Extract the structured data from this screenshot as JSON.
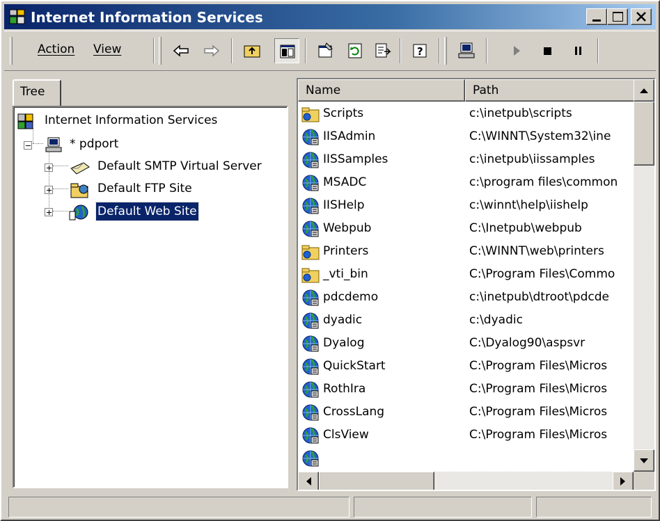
{
  "window": {
    "title": "Internet Information Services",
    "controls": {
      "minimize": "minimize",
      "maximize": "maximize",
      "close": "close"
    }
  },
  "menu": [
    {
      "label": "Action",
      "accel": "A"
    },
    {
      "label": "View",
      "accel": "V"
    }
  ],
  "toolbar": [
    {
      "name": "back",
      "icon": "arrow-left-icon"
    },
    {
      "name": "forward",
      "icon": "arrow-right-icon"
    },
    {
      "name": "up-one-level",
      "icon": "folder-up-icon"
    },
    {
      "name": "show-hide-console-tree",
      "icon": "console-tree-icon",
      "pressed": true
    },
    {
      "name": "properties",
      "icon": "properties-icon"
    },
    {
      "name": "refresh",
      "icon": "refresh-icon"
    },
    {
      "name": "export-list",
      "icon": "export-list-icon"
    },
    {
      "name": "help",
      "icon": "help-icon"
    },
    {
      "name": "connect-computer",
      "icon": "computer-icon"
    },
    {
      "name": "start",
      "icon": "play-icon"
    },
    {
      "name": "stop",
      "icon": "stop-icon"
    },
    {
      "name": "pause",
      "icon": "pause-icon"
    }
  ],
  "tree": {
    "tab_label": "Tree",
    "items": [
      {
        "label": "Internet Information Services",
        "icon": "iis-root-icon",
        "level": 0
      },
      {
        "label": "* pdport",
        "icon": "computer-icon",
        "level": 1,
        "expander": "minus"
      },
      {
        "label": "Default SMTP Virtual Server",
        "icon": "smtp-server-icon",
        "level": 2,
        "expander": "plus"
      },
      {
        "label": "Default FTP Site",
        "icon": "ftp-site-icon",
        "level": 2,
        "expander": "plus"
      },
      {
        "label": "Default Web Site",
        "icon": "web-site-icon",
        "level": 2,
        "expander": "plus",
        "selected": true
      }
    ]
  },
  "list": {
    "columns": [
      "Name",
      "Path"
    ],
    "rows": [
      {
        "name": "Scripts",
        "path": "c:\\inetpub\\scripts",
        "icon": "folder-icon"
      },
      {
        "name": "IISAdmin",
        "path": "C:\\WINNT\\System32\\ine",
        "icon": "web-app-icon"
      },
      {
        "name": "IISSamples",
        "path": "c:\\inetpub\\iissamples",
        "icon": "web-app-icon"
      },
      {
        "name": "MSADC",
        "path": "c:\\program files\\common",
        "icon": "web-app-icon"
      },
      {
        "name": "IISHelp",
        "path": "c:\\winnt\\help\\iishelp",
        "icon": "web-app-icon"
      },
      {
        "name": "Webpub",
        "path": "C:\\Inetpub\\webpub",
        "icon": "web-app-icon"
      },
      {
        "name": "Printers",
        "path": "C:\\WINNT\\web\\printers",
        "icon": "folder-icon"
      },
      {
        "name": "_vti_bin",
        "path": "C:\\Program Files\\Commo",
        "icon": "folder-icon"
      },
      {
        "name": "pdcdemo",
        "path": "c:\\inetpub\\dtroot\\pdcde",
        "icon": "web-app-icon"
      },
      {
        "name": "dyadic",
        "path": "c:\\dyadic",
        "icon": "web-app-icon"
      },
      {
        "name": "Dyalog",
        "path": "C:\\Dyalog90\\aspsvr",
        "icon": "web-app-icon"
      },
      {
        "name": "QuickStart",
        "path": "C:\\Program Files\\Micros",
        "icon": "web-app-icon"
      },
      {
        "name": "RothIra",
        "path": "C:\\Program Files\\Micros",
        "icon": "web-app-icon"
      },
      {
        "name": "CrossLang",
        "path": "C:\\Program Files\\Micros",
        "icon": "web-app-icon"
      },
      {
        "name": "ClsView",
        "path": "C:\\Program Files\\Micros",
        "icon": "web-app-icon"
      },
      {
        "name": "",
        "path": "",
        "icon": "web-app-icon"
      }
    ]
  },
  "statusbar": [
    "",
    "",
    ""
  ],
  "colors": {
    "titlebar": "#0a246a",
    "face": "#d4d0c8",
    "selection": "#0a246a"
  }
}
